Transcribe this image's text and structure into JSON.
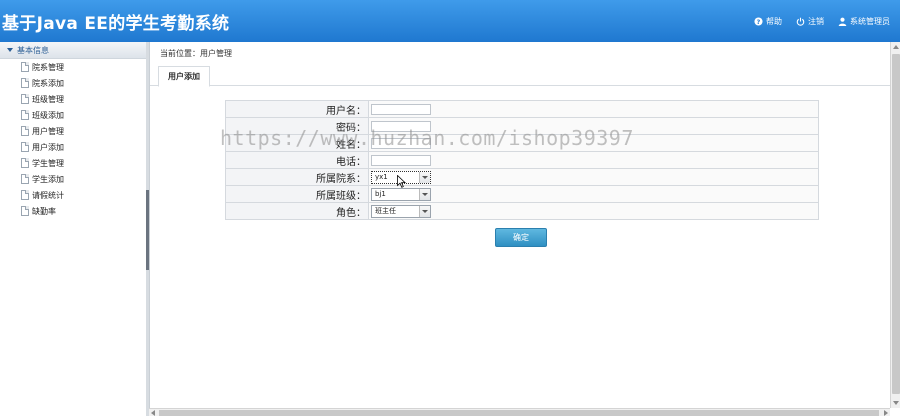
{
  "header": {
    "title": "基于Java EE的学生考勤系统",
    "nav": {
      "help": "帮助",
      "logout": "注销",
      "user": "系统管理员"
    }
  },
  "sidebar": {
    "group_title": "基本信息",
    "items": [
      {
        "label": "院系管理"
      },
      {
        "label": "院系添加"
      },
      {
        "label": "班级管理"
      },
      {
        "label": "班级添加"
      },
      {
        "label": "用户管理"
      },
      {
        "label": "用户添加"
      },
      {
        "label": "学生管理"
      },
      {
        "label": "学生添加"
      },
      {
        "label": "请假统计"
      },
      {
        "label": "缺勤率"
      }
    ]
  },
  "main": {
    "breadcrumb": "当前位置：用户管理",
    "tab": "用户添加",
    "watermark": "https://www.huzhan.com/ishop39397",
    "form": {
      "username_label": "用户名：",
      "username_value": "",
      "password_label": "密码：",
      "password_value": "",
      "name_label": "姓名：",
      "name_value": "",
      "phone_label": "电话：",
      "phone_value": "",
      "department_label": "所属院系：",
      "department_value": "yx1",
      "class_label": "所属班级：",
      "class_value": "bj1",
      "role_label": "角色：",
      "role_value": "班主任"
    },
    "submit_label": "确定"
  }
}
